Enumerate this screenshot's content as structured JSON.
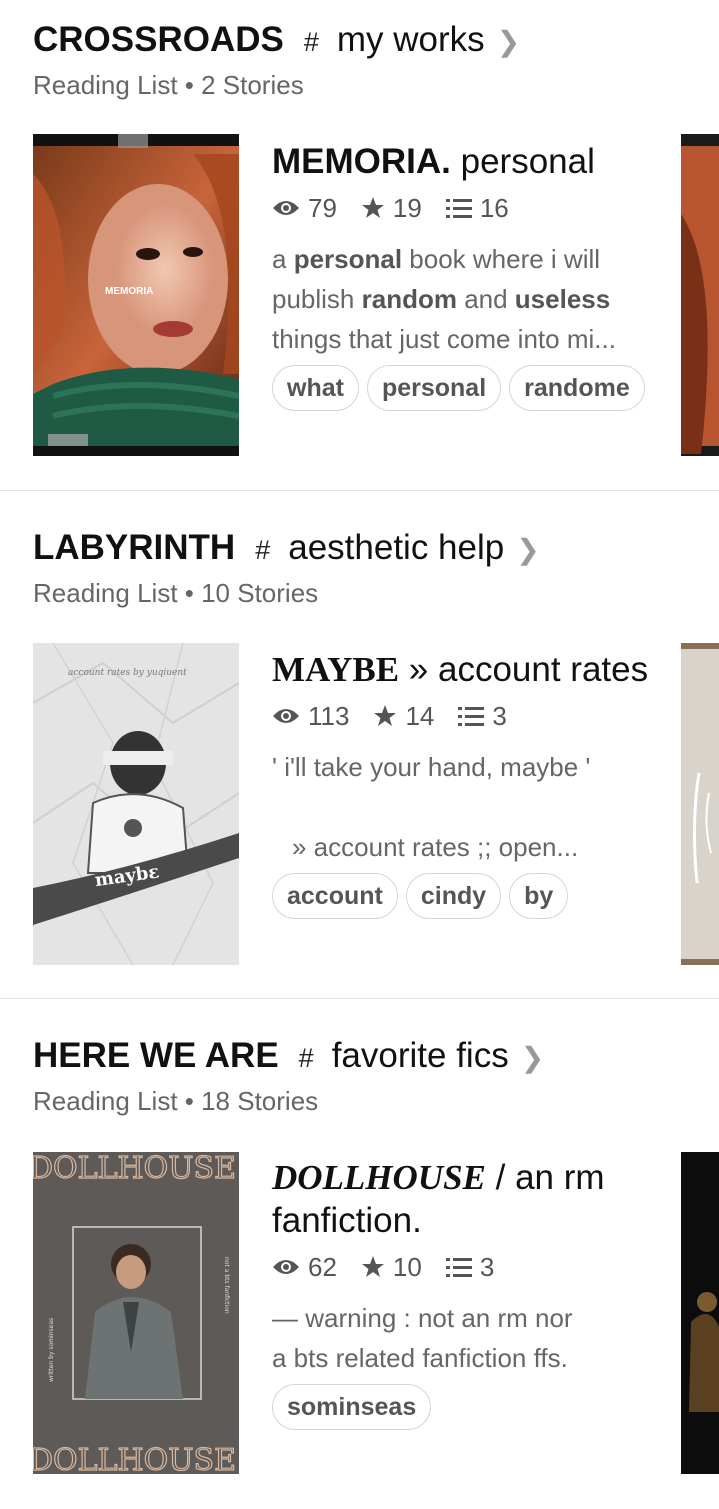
{
  "lists": [
    {
      "title": "CROSSROADS",
      "hash": "#",
      "subtitle": "my works",
      "meta": "Reading List • 2 Stories",
      "story": {
        "title_bold": "MEMORIA.",
        "title_rest": " personal",
        "views": "79",
        "votes": "19",
        "parts": "16",
        "description": [
          "a ",
          "personal",
          " book where i will publish ",
          "random",
          " and ",
          "useless",
          " things that just come into mi..."
        ],
        "tags": [
          "what",
          "personal",
          "randome"
        ],
        "cover_text": "MEMORIA"
      }
    },
    {
      "title": "LABYRINTH",
      "hash": "#",
      "subtitle": "aesthetic help",
      "meta": "Reading List • 10 Stories",
      "story": {
        "title_bold": "MAYBE",
        "title_rest": " » account rates",
        "views": "113",
        "votes": "14",
        "parts": "3",
        "description_line1": "' i'll take your hand, maybe '",
        "description_line2": "» account rates ;; open...",
        "tags": [
          "account",
          "cindy",
          "by"
        ],
        "cover_top": "account rates by yuqiuent",
        "cover_text": "maybε"
      }
    },
    {
      "title": "HERE WE ARE",
      "hash": "#",
      "subtitle": "favorite fics",
      "meta": "Reading List • 18 Stories",
      "story": {
        "title_bold": "DOLLHOUSE",
        "title_rest": " / an rm fanfiction.",
        "views": "62",
        "votes": "10",
        "parts": "3",
        "description_line1": "— warning : not an rm nor",
        "description_line2": "a bts related fanfiction ffs.",
        "tags": [
          "sominseas"
        ],
        "cover_text": "DOLLHOUSE",
        "cover_side_left": "written by sominseas",
        "cover_side_right": "not a bts fanfiction"
      }
    }
  ]
}
